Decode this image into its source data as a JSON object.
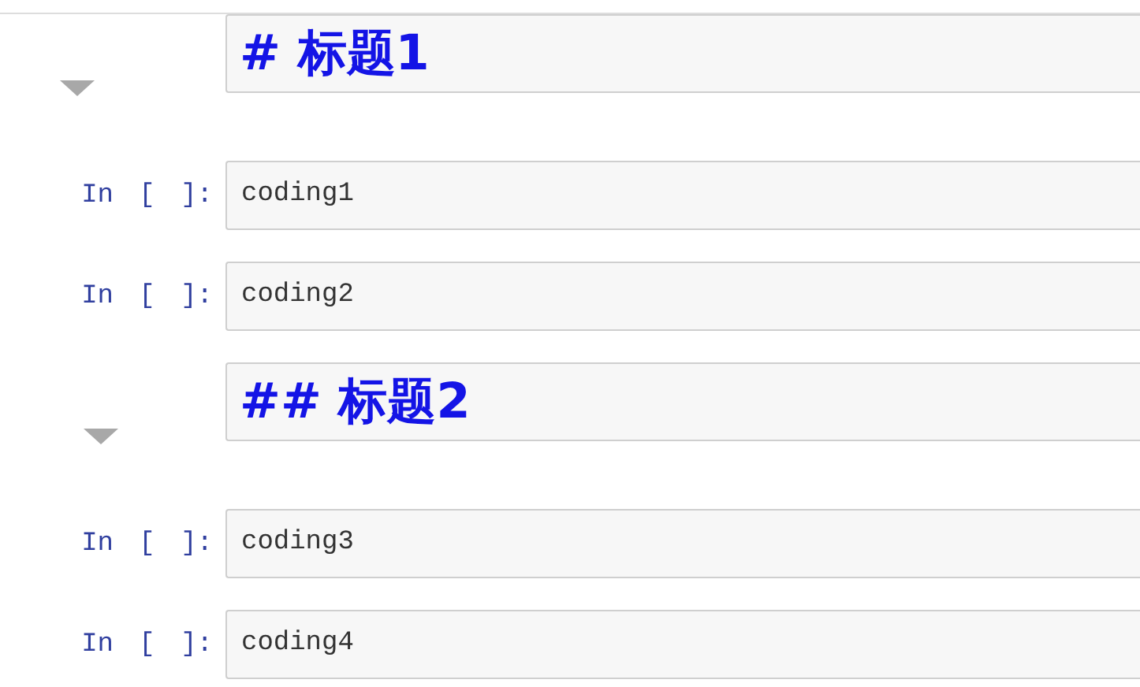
{
  "cells": [
    {
      "kind": "heading",
      "source": "# 标题1",
      "expanded": true,
      "children": [
        {
          "kind": "code",
          "prompt": "In [ ]:",
          "source": "coding1"
        },
        {
          "kind": "code",
          "prompt": "In [ ]:",
          "source": "coding2"
        },
        {
          "kind": "heading",
          "source": "## 标题2",
          "expanded": true,
          "children": [
            {
              "kind": "code",
              "prompt": "In [ ]:",
              "source": "coding3"
            },
            {
              "kind": "code",
              "prompt": "In [ ]:",
              "source": "coding4"
            }
          ]
        }
      ]
    }
  ]
}
